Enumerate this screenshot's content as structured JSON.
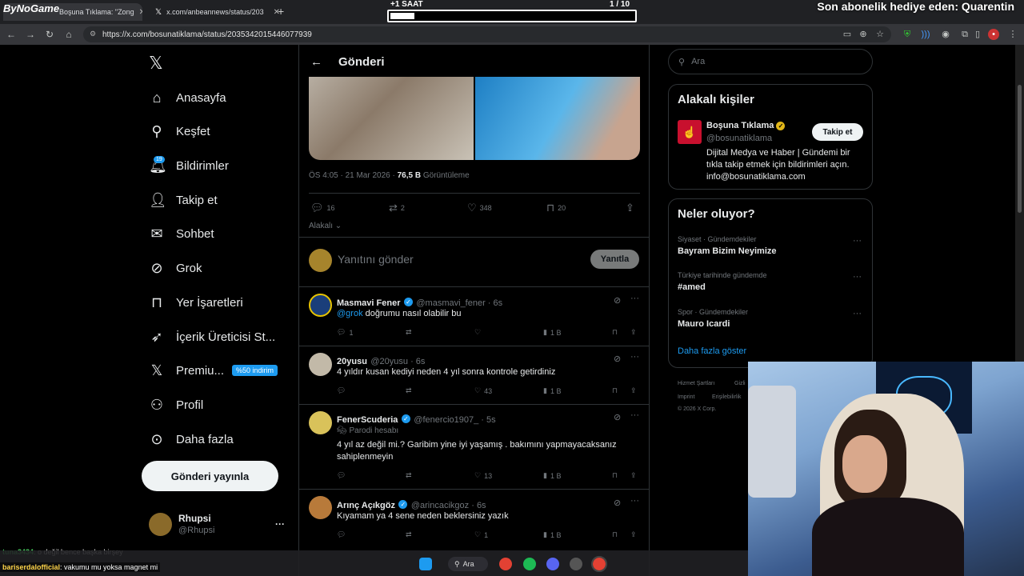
{
  "browser": {
    "tabs": [
      {
        "label": "Boşuna Tıklama: \"Zong"
      },
      {
        "label": "x.com/anbeannews/status/203"
      }
    ],
    "new_tab": "+",
    "url": "https://x.com/bosunatiklama/status/2035342015446077939",
    "logo_text": "ByNoGame"
  },
  "stream": {
    "timer_label": "+1 SAAT",
    "counter": "1  / 10",
    "progress": 0.1,
    "subscriber_text": "Son abonelik hediye eden: Quarentin"
  },
  "sidebar": {
    "items": [
      {
        "label": "Anasayfa",
        "icon": "home-icon"
      },
      {
        "label": "Keşfet",
        "icon": "search-icon"
      },
      {
        "label": "Bildirimler",
        "icon": "bell-icon"
      },
      {
        "label": "Takip et",
        "icon": "add-user-icon"
      },
      {
        "label": "Sohbet",
        "icon": "mail-icon"
      },
      {
        "label": "Grok",
        "icon": "grok-icon"
      },
      {
        "label": "Yer İşaretleri",
        "icon": "bookmark-icon"
      },
      {
        "label": "İçerik Üreticisi St...",
        "icon": "rocket-icon"
      },
      {
        "label": "Premiu...",
        "icon": "x-icon"
      },
      {
        "label": "Profil",
        "icon": "person-icon"
      },
      {
        "label": "Daha fazla",
        "icon": "more-icon"
      }
    ],
    "notif_count": "19",
    "premium_badge": "%50 indirim",
    "post_button": "Gönderi yayınla",
    "profile": {
      "name": "Rhupsi",
      "handle": "@Rhupsi",
      "more": "···"
    }
  },
  "main": {
    "title": "Gönderi",
    "meta": {
      "time": "ÖS 4:05 · 21 Mar 2026 · ",
      "views": "76,5 B",
      "views_label": " Görüntüleme"
    },
    "stats": {
      "replies": "16",
      "reposts": "2",
      "likes": "348",
      "bookmarks": "20"
    },
    "relevance": "Alakalı",
    "reply_placeholder": "Yanıtını gönder",
    "reply_button": "Yanıtla",
    "replies": [
      {
        "name": "Masmavi Fener",
        "handle": "@masmavi_fener · 6s",
        "mention": "@grok",
        "text": " doğrumu nasıl olabilir bu",
        "replies": "1",
        "reposts": "",
        "likes": "",
        "views": "1 B"
      },
      {
        "name": "20yusu",
        "handle": "@20yusu · 6s",
        "mention": "",
        "text": "4 yıldır kusan kediyi neden 4 yıl sonra kontrole getirdiniz",
        "replies": "",
        "reposts": "",
        "likes": "43",
        "views": "1 B"
      },
      {
        "name": "FenerScuderia",
        "handle": "@fenercio1907_ · 5s",
        "parody": "Parodi hesabı",
        "mention": "",
        "text": "4 yıl az değil mi.? Garibim yine iyi yaşamış . bakımını yapmayacaksanız sahiplenmeyin",
        "replies": "",
        "reposts": "",
        "likes": "13",
        "views": "1 B"
      },
      {
        "name": "Arınç Açıkgöz",
        "handle": "@arincacikgoz · 6s",
        "mention": "",
        "text": "Kıyamam ya 4 sene neden beklersiniz yazık",
        "replies": "",
        "reposts": "",
        "likes": "1",
        "views": "1 B"
      }
    ]
  },
  "right": {
    "search_placeholder": "Ara",
    "related": {
      "title": "Alakalı kişiler",
      "name": "Boşuna Tıklama",
      "handle": "@bosunatiklama",
      "bio": "Dijital Medya ve Haber | Gündemi bir tıkla takip etmek için bildirimleri açın. info@bosunatiklama.com",
      "follow": "Takip et"
    },
    "trends": {
      "title": "Neler oluyor?",
      "items": [
        {
          "context": "Siyaset · Gündemdekiler",
          "name": "Bayram Bizim Neyimize"
        },
        {
          "context": "Türkiye tarihinde gündemde",
          "name": "#amed"
        },
        {
          "context": "Spor · Gündemdekiler",
          "name": "Mauro Icardi"
        }
      ],
      "more": "Daha fazla göster"
    },
    "footer": [
      "Hizmet Şartları",
      "Gizli",
      "Imprint",
      "Erişilebilirlik",
      "© 2026 X Corp."
    ]
  },
  "chat": [
    {
      "user": "tuna3434",
      "text": ": o değil bence başka birşey"
    },
    {
      "user": "bariserdalofficial",
      "text": ": vakumu mu yoksa magnet mi"
    }
  ],
  "taskbar": {
    "search": "Ara"
  },
  "colors": {
    "accent": "#1d9bf0",
    "verified_gold": "#e2b719"
  }
}
